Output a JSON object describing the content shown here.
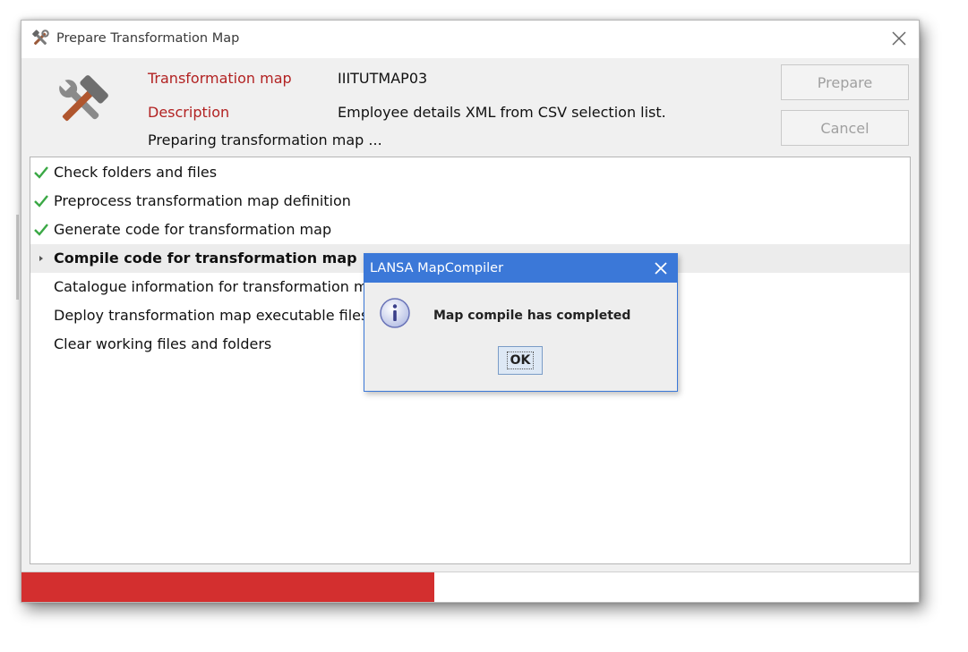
{
  "window": {
    "title": "Prepare Transformation Map",
    "icon": "tools-icon",
    "close_icon": "close-icon"
  },
  "header": {
    "map_label": "Transformation map",
    "map_value": "IIITUTMAP03",
    "description_label": "Description",
    "description_value": "Employee details XML from CSV selection list.",
    "status_text": "Preparing transformation map ..."
  },
  "buttons": {
    "prepare": "Prepare",
    "cancel": "Cancel"
  },
  "steps": [
    {
      "label": "Check folders and files",
      "state": "done"
    },
    {
      "label": "Preprocess transformation map definition",
      "state": "done"
    },
    {
      "label": "Generate code for transformation map",
      "state": "done"
    },
    {
      "label": "Compile code for transformation map",
      "state": "active"
    },
    {
      "label": "Catalogue information for transformation map",
      "state": "pending"
    },
    {
      "label": "Deploy transformation map executable files",
      "state": "pending"
    },
    {
      "label": "Clear working files and folders",
      "state": "pending"
    }
  ],
  "progress": {
    "fraction": 0.46,
    "color": "#d32f2f"
  },
  "dialog": {
    "title": "LANSA MapCompiler",
    "message": "Map compile has completed",
    "ok_label": "OK",
    "icon": "info-icon",
    "accent": "#3b78d8"
  }
}
